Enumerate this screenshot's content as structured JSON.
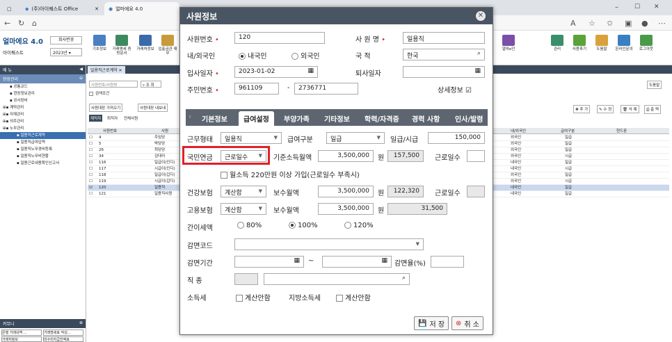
{
  "browser": {
    "tab1": "(주)아이퀘스트 Office",
    "tab2": "얼마에요 4.0",
    "controls": {
      "min": "–",
      "max": "☐",
      "close": "✕"
    }
  },
  "app": {
    "logo": "얼마에요 4.0",
    "company_button": "회사변경",
    "company_name": "아이퀘스트",
    "year_select": "2023년",
    "toolbar_left": [
      "기초정보",
      "거래명세\n증빙문서",
      "거래처정보",
      "입출금관\n재무"
    ],
    "toolbar_mid": "얼마e안",
    "toolbar_right": [
      "관리",
      "사용후기",
      "도움말",
      "온라인문의",
      "로그아웃"
    ]
  },
  "left_panel": {
    "header": "메 뉴",
    "section": "현장관리",
    "tree": [
      {
        "label": "공통코드",
        "level": 1,
        "selected": false
      },
      {
        "label": "현장정보관리",
        "level": 1,
        "selected": false
      },
      {
        "label": "공사장비",
        "level": 1,
        "selected": false
      },
      {
        "label": "계약관리",
        "level": 0,
        "selected": false
      },
      {
        "label": "자재관리",
        "level": 0,
        "selected": false
      },
      {
        "label": "외주관리",
        "level": 0,
        "selected": false
      },
      {
        "label": "노무관리",
        "level": 0,
        "selected": false
      },
      {
        "label": "일용직근로계약",
        "level": 2,
        "selected": true
      },
      {
        "label": "일용직급여입력",
        "level": 2,
        "selected": false
      },
      {
        "label": "일용직노무경비등록",
        "level": 2,
        "selected": false
      },
      {
        "label": "일용직노무비현황",
        "level": 2,
        "selected": false
      },
      {
        "label": "일용근로내용확인신고서",
        "level": 2,
        "selected": false
      }
    ],
    "bottom_header": "커뮤니",
    "bottom_buttons": [
      "은행 거래내역 ...",
      "거래명세표 작성...",
      "거래처정보",
      "미수미지급잔액표"
    ]
  },
  "main": {
    "tab": "일용직근로계약",
    "search_placeholder": "사원번호/사원명",
    "search_button": "조 회",
    "search_condition": "검색조건",
    "load_buttons": [
      "사원대장 가져오기",
      "사원대장 내보내"
    ],
    "sub_tabs": [
      "재직자",
      "퇴직자",
      "전체사원"
    ],
    "help_button": "도움말",
    "action_buttons": [
      "추 가",
      "수 정",
      "삭 제",
      "출 력"
    ],
    "columns_left": [
      "사원번호",
      "사원"
    ],
    "columns_right": [
      "내/외국인",
      "급여구분",
      "현드폰"
    ],
    "rows": [
      {
        "no": "4",
        "name": "주임당",
        "nation": "외국인",
        "pay": "일급",
        "sel": false
      },
      {
        "no": "5",
        "name": "박당당",
        "nation": "외국인",
        "pay": "일급",
        "sel": false
      },
      {
        "no": "26",
        "name": "최당당",
        "nation": "외국인",
        "pay": "일급",
        "sel": false
      },
      {
        "no": "34",
        "name": "김대리",
        "nation": "외국인",
        "pay": "시급",
        "sel": false
      },
      {
        "no": "116",
        "name": "일급이(인디)",
        "nation": "내국인",
        "pay": "일급",
        "sel": false
      },
      {
        "no": "117",
        "name": "시급이(인디)",
        "nation": "내국인",
        "pay": "시급",
        "sel": false
      },
      {
        "no": "118",
        "name": "일급이(갑디)",
        "nation": "외국인",
        "pay": "일급",
        "sel": false
      },
      {
        "no": "119",
        "name": "시급이(갑디)",
        "nation": "외국인",
        "pay": "시급",
        "sel": false
      },
      {
        "no": "120",
        "name": "일용직",
        "nation": "내국인",
        "pay": "일급",
        "sel": true
      },
      {
        "no": "121",
        "name": "일용직사원",
        "nation": "내국인",
        "pay": "일급",
        "sel": false
      }
    ]
  },
  "dialog": {
    "title": "사원정보",
    "emp_no_label": "사원번호",
    "emp_no": "120",
    "emp_name_label": "사 원 명",
    "emp_name": "일용직",
    "foreign_label": "내/외국인",
    "domestic": "내국인",
    "foreign": "외국인",
    "nationality_label": "국  적",
    "nationality": "한국",
    "join_label": "입사일자",
    "join_date": "2023-01-02",
    "leave_label": "퇴사일자",
    "leave_date": "",
    "rrn_label": "주민번호",
    "rrn1": "961109",
    "rrn_sep": "-",
    "rrn2": "2736771",
    "detail_label": "상세정보",
    "tabs": [
      "기본정보",
      "급여설정",
      "부양가족",
      "기타정보",
      "학력/자격증",
      "경력 사항",
      "인사/발령"
    ],
    "work_type_label": "근무형태",
    "work_type": "일용직",
    "pay_type_label": "급여구분",
    "pay_type": "일급",
    "wage_label": "일급/시급",
    "wage": "150,000",
    "pension_label": "국민연금",
    "pension_basis": "근로일수",
    "base_income_label": "기준소득월액",
    "base_income": "3,500,000",
    "won": "원",
    "pension_amt": "157,500",
    "workdays_label": "근로일수",
    "workdays": "",
    "monthly_check_label": "월소득 220만원 이상 가입(근로일수 부족시)",
    "health_label": "건강보험",
    "health_basis": "계산함",
    "salary_label": "보수월액",
    "health_salary": "3,500,000",
    "health_amt": "122,320",
    "health_days_label": "근로일수",
    "employ_label": "고용보험",
    "employ_basis": "계산함",
    "employ_salary": "3,500,000",
    "employ_amt": "31,500",
    "simple_tax_label": "간이세액",
    "rate_80": "80%",
    "rate_100": "100%",
    "rate_120": "120%",
    "reduction_code_label": "감면코드",
    "reduction_period_label": "감면기간",
    "tilde": "~",
    "reduction_rate_label": "감면율(%)",
    "job_label": "직 종",
    "income_tax_label": "소득세",
    "no_calc": "계산안함",
    "local_tax_label": "지방소득세",
    "local_no_calc": "계산안함",
    "save_button": "저 장",
    "cancel_button": "취 소"
  },
  "colors": {
    "title_bar": "#4a5563",
    "tab_strip": "#5d6570",
    "highlight": "#e0202a",
    "required": "#e03030"
  }
}
